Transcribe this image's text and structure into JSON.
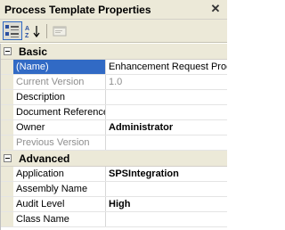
{
  "window": {
    "title": "Process Template Properties",
    "close_glyph": "✕"
  },
  "toolbar": {
    "buttons": [
      {
        "name": "categorized-view",
        "icon": "categorized-icon",
        "active": true
      },
      {
        "name": "alphabetical-sort",
        "icon": "az-sort-icon",
        "active": false
      },
      {
        "name": "property-pages",
        "icon": "property-pages-icon",
        "active": false,
        "disabled": true
      }
    ]
  },
  "categories": [
    {
      "label": "Basic",
      "rows": [
        {
          "name": "(Name)",
          "value": "Enhancement Request Proc",
          "selected": true
        },
        {
          "name": "Current Version",
          "value": "1.0",
          "readonly": true
        },
        {
          "name": "Description",
          "value": ""
        },
        {
          "name": "Document Reference",
          "value": ""
        },
        {
          "name": "Owner",
          "value": "Administrator",
          "bold": true
        },
        {
          "name": "Previous Version",
          "value": "",
          "readonly": true
        }
      ]
    },
    {
      "label": "Advanced",
      "rows": [
        {
          "name": "Application",
          "value": "SPSIntegration",
          "bold": true
        },
        {
          "name": "Assembly Name",
          "value": ""
        },
        {
          "name": "Audit Level",
          "value": "High",
          "bold": true
        },
        {
          "name": "Class Name",
          "value": ""
        }
      ]
    }
  ],
  "colors": {
    "selection": "#316ac5",
    "chrome": "#ece9d8",
    "readonly_text": "#8e8e8e"
  }
}
